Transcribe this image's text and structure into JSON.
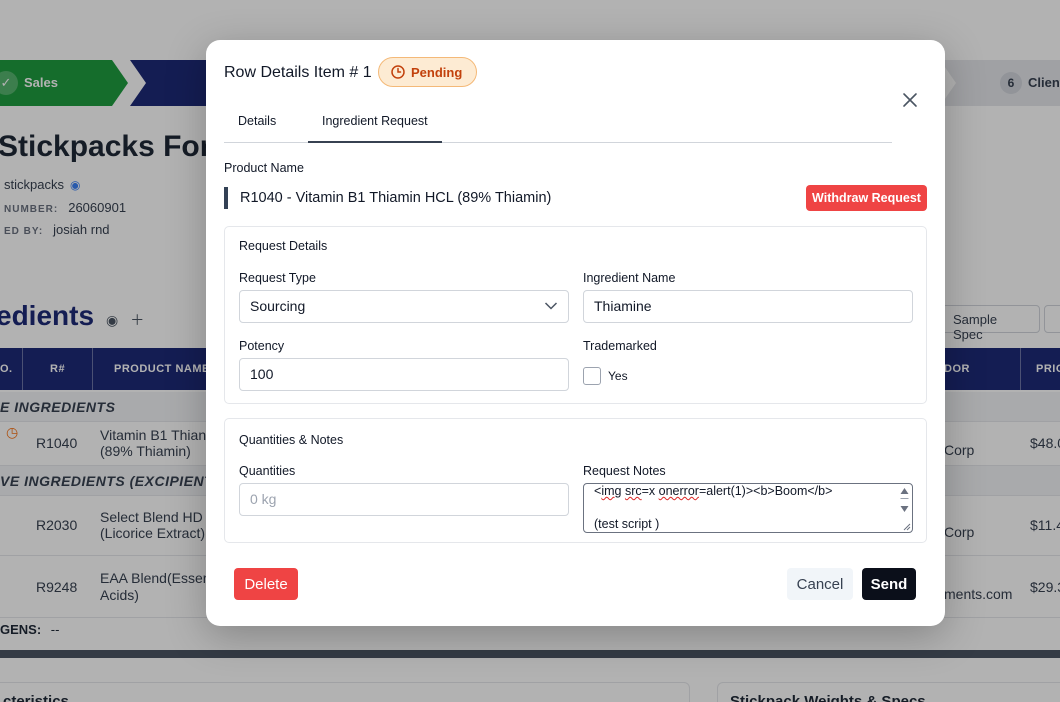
{
  "background": {
    "stepper": {
      "sales_label": "Sales",
      "right_step_number": "6",
      "right_step_label": "Client"
    },
    "page_title": "Stickpacks Form",
    "meta": {
      "type_value": "stickpacks",
      "number_key": "NUMBER:",
      "number_value": "26060901",
      "created_key": "ED BY:",
      "created_value": "josiah rnd"
    },
    "section_title": "edients",
    "sample_spec_label": "Sample Spec",
    "table": {
      "headers": {
        "no": "O.",
        "r": "R#",
        "product_name": "PRODUCT NAME",
        "vendor": "DOR",
        "price": "PRIC"
      },
      "group1": "E INGREDIENTS",
      "group2": "VE INGREDIENTS (EXCIPIENT",
      "rows": [
        {
          "r": "R1040",
          "name1": "Vitamin B1 Thian",
          "name2": "(89% Thiamin)",
          "vendor": "Corp",
          "price": "$48.0"
        },
        {
          "r": "R2030",
          "name1": "Select Blend HD",
          "name2": "(Licorice Extract)",
          "vendor": "Corp",
          "price": "$11.4"
        },
        {
          "r": "R9248",
          "name1": "EAA Blend(Esser",
          "name2": "Acids)",
          "vendor": "ments.com",
          "price": "$29.3"
        }
      ],
      "allergens_label": "GENS:",
      "allergens_value": "--"
    },
    "bottom_cards": {
      "left": "cteristics",
      "right": "Stickpack Weights & Specs"
    }
  },
  "modal": {
    "title": "Row Details Item # 1",
    "status_badge": "Pending",
    "tabs": [
      {
        "label": "Details",
        "active": false
      },
      {
        "label": "Ingredient Request",
        "active": true
      }
    ],
    "product_name_label": "Product Name",
    "product_name_value": "R1040 - Vitamin B1 Thiamin HCL (89% Thiamin)",
    "withdraw_label": "Withdraw Request",
    "request_details": {
      "title": "Request Details",
      "request_type_label": "Request Type",
      "request_type_value": "Sourcing",
      "ingredient_name_label": "Ingredient Name",
      "ingredient_name_value": "Thiamine",
      "potency_label": "Potency",
      "potency_value": "100",
      "trademarked_label": "Trademarked",
      "trademarked_option": "Yes",
      "trademarked_checked": false
    },
    "quantities_notes": {
      "title": "Quantities & Notes",
      "quantities_label": "Quantities",
      "quantities_placeholder": "0 kg",
      "notes_label": "Request Notes",
      "notes_line1_a": "<",
      "notes_line1_b": "img",
      "notes_line1_c": " ",
      "notes_line1_d": "src",
      "notes_line1_e": "=x ",
      "notes_line1_f": "onerror",
      "notes_line1_g": "=alert(1)><b>Boom</b>",
      "notes_line2": "(test script )"
    },
    "footer": {
      "delete_label": "Delete",
      "cancel_label": "Cancel",
      "send_label": "Send"
    }
  },
  "colors": {
    "accent_green": "#1f9d3f",
    "accent_navy": "#1e2a78",
    "danger": "#ef4444",
    "pending_text": "#c2410c",
    "pending_bg": "#fdebd3"
  }
}
